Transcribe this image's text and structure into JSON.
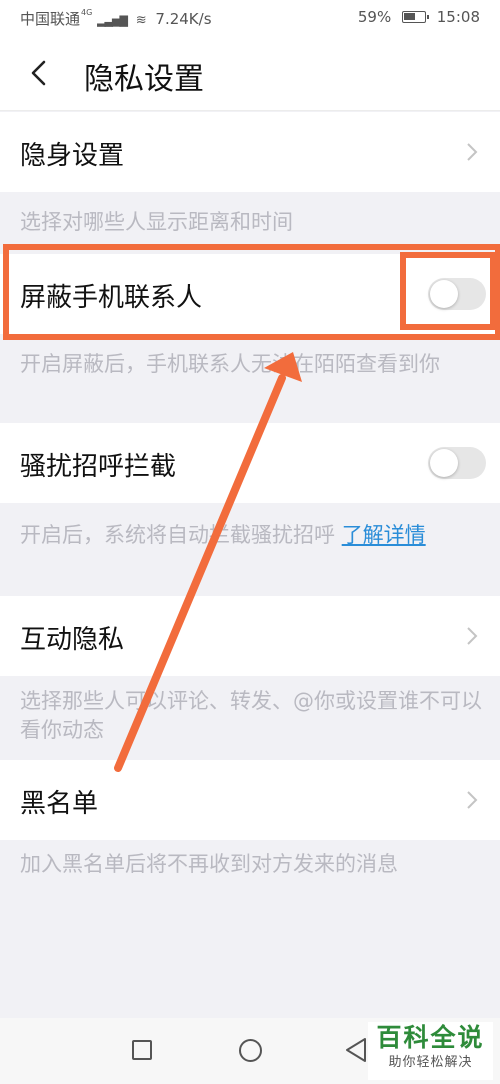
{
  "status_bar": {
    "carrier": "中国联通",
    "network_tag": "4G",
    "speed": "7.24K/s",
    "battery_percent": "59%",
    "battery_level": 0.59,
    "time": "15:08"
  },
  "nav": {
    "title": "隐私设置"
  },
  "settings": {
    "stealth": {
      "label": "隐身设置",
      "desc": "选择对哪些人显示距离和时间"
    },
    "block_contacts": {
      "label": "屏蔽手机联系人",
      "enabled": false,
      "desc": "开启屏蔽后，手机联系人无法在陌陌查看到你"
    },
    "harass": {
      "label": "骚扰招呼拦截",
      "enabled": false,
      "desc": "开启后，系统将自动拦截骚扰招呼 ",
      "link": "了解详情"
    },
    "interaction": {
      "label": "互动隐私",
      "desc": "选择那些人可以评论、转发、@你或设置谁不可以看你动态"
    },
    "blacklist": {
      "label": "黑名单",
      "desc": "加入黑名单后将不再收到对方发来的消息"
    }
  },
  "watermark": {
    "title": "百科全说",
    "subtitle": "助你轻松解决"
  },
  "colors": {
    "highlight": "#f26c3c",
    "link": "#2a8dd8",
    "background": "#f1f1f5",
    "toggle_off": "#e6e6e6"
  }
}
